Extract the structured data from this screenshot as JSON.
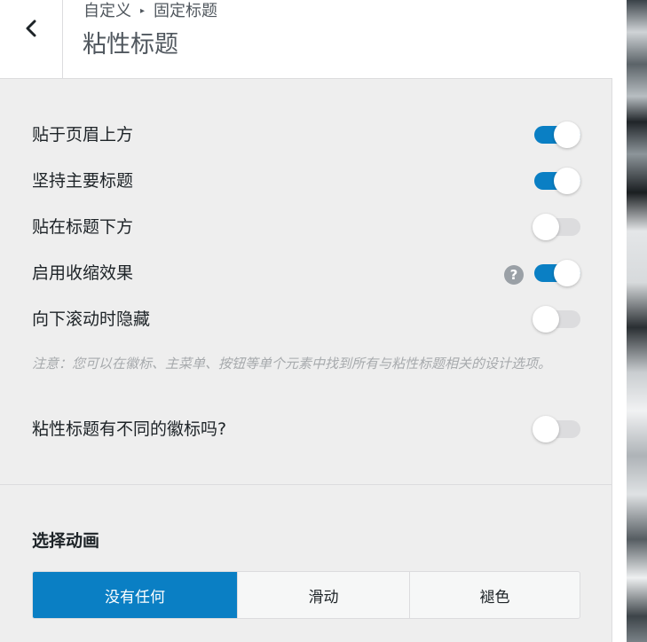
{
  "header": {
    "breadcrumb_parent": "自定义",
    "breadcrumb_separator": "▸",
    "breadcrumb_current": "固定标题",
    "title": "粘性标题"
  },
  "toggles": [
    {
      "label": "贴于页眉上方",
      "on": true
    },
    {
      "label": "坚持主要标题",
      "on": true
    },
    {
      "label": "贴在标题下方",
      "on": false
    },
    {
      "label": "启用收缩效果",
      "on": true,
      "has_help": true
    },
    {
      "label": "向下滚动时隐藏",
      "on": false
    }
  ],
  "help_icon_text": "?",
  "note": "注意：您可以在徽标、主菜单、按钮等单个元素中找到所有与粘性标题相关的设计选项。",
  "logo_toggle": {
    "label": "粘性标题有不同的徽标吗?",
    "on": false
  },
  "animation": {
    "title": "选择动画",
    "options": [
      "没有任何",
      "滑动",
      "褪色"
    ],
    "selected": "没有任何"
  },
  "colors": {
    "accent": "#0a7fc4",
    "toggle_off": "#dcdcde",
    "panel_bg": "#eeeeee"
  }
}
